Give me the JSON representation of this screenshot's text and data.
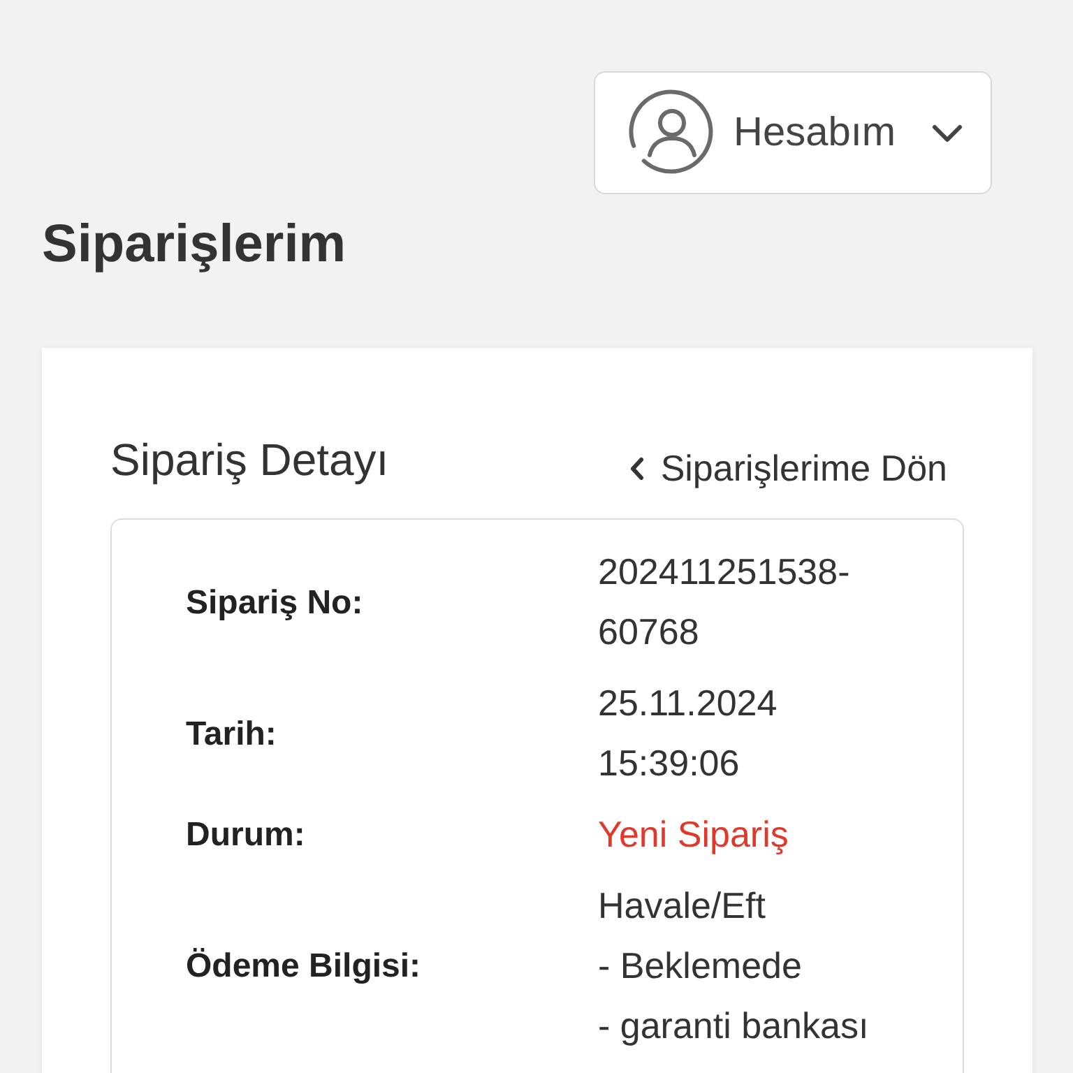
{
  "account_button": {
    "label": "Hesabım"
  },
  "page_title": "Siparişlerim",
  "order_detail": {
    "title": "Sipariş Detayı",
    "back_link": "Siparişlerime Dön",
    "rows": [
      {
        "kind": "text",
        "label": "Sipariş No:",
        "value": "202411251538-60768"
      },
      {
        "kind": "text",
        "label": "Tarih:",
        "value": "25.11.2024 15:39:06"
      },
      {
        "kind": "text",
        "label": "Durum:",
        "value": "Yeni Sipariş",
        "color": "#e0392b"
      },
      {
        "kind": "lines",
        "label": "Ödeme Bilgisi:",
        "lines": [
          "Havale/Eft",
          "- Beklemede",
          "- garanti bankası"
        ]
      }
    ]
  }
}
